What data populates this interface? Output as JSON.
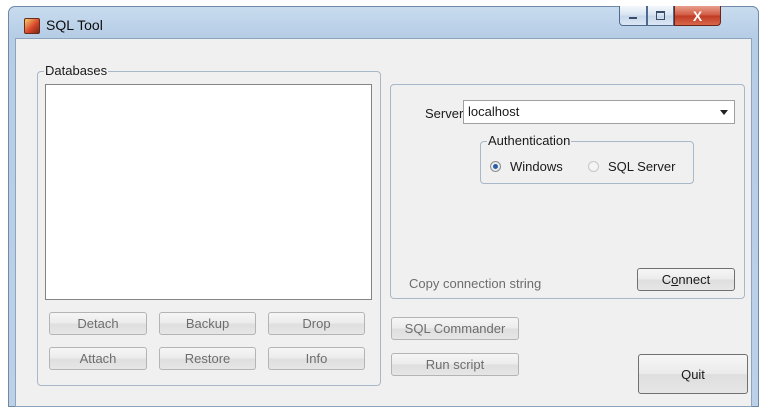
{
  "window": {
    "title": "SQL Tool",
    "controls": {
      "minimize_icon": "minimize-icon",
      "maximize_icon": "maximize-icon",
      "close_glyph": "X"
    }
  },
  "databases": {
    "group_label": "Databases",
    "items": [],
    "buttons": {
      "detach": "Detach",
      "backup": "Backup",
      "drop": "Drop",
      "attach": "Attach",
      "restore": "Restore",
      "info": "Info"
    }
  },
  "connection": {
    "server_label": "Server",
    "server_value": "localhost",
    "authentication": {
      "group_label": "Authentication",
      "options": [
        {
          "label": "Windows",
          "checked": true
        },
        {
          "label": "SQL Server",
          "checked": false
        }
      ]
    },
    "copy_connection_label": "Copy connection string",
    "connect_button": {
      "pre": "C",
      "underline": "o",
      "post": "nnect"
    }
  },
  "actions": {
    "sql_commander": "SQL Commander",
    "run_script": "Run script",
    "quit": "Quit"
  },
  "colors": {
    "frame": "#bcd1e8",
    "client": "#f0f0f0",
    "close_button": "#c03a23",
    "radio_selected": "#2a5fa8"
  }
}
